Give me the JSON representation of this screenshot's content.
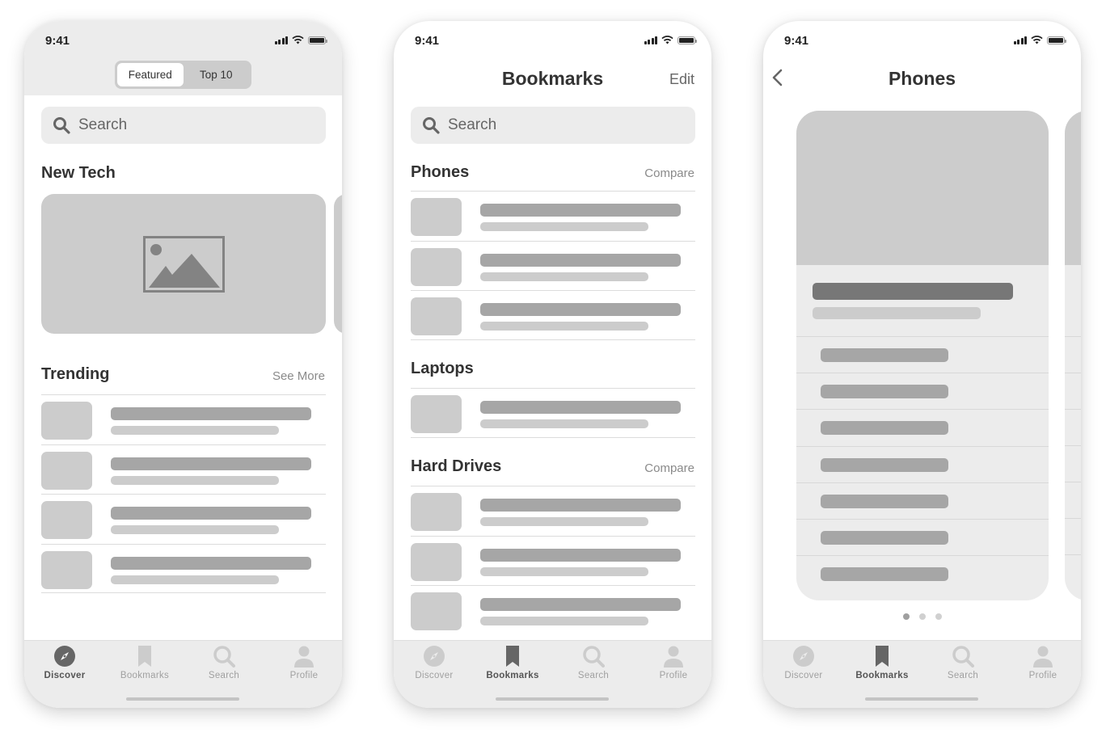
{
  "status_bar": {
    "time": "9:41"
  },
  "discover_screen": {
    "segmented": [
      {
        "label": "Featured",
        "active": true
      },
      {
        "label": "Top 10",
        "active": false
      }
    ],
    "search_placeholder": "Search",
    "new_tech_title": "New Tech",
    "trending_title": "Trending",
    "see_more": "See More",
    "trending_count": 4
  },
  "bookmarks_screen": {
    "title": "Bookmarks",
    "edit": "Edit",
    "search_placeholder": "Search",
    "sections": [
      {
        "title": "Phones",
        "action": "Compare",
        "count": 3
      },
      {
        "title": "Laptops",
        "action": "",
        "count": 1
      },
      {
        "title": "Hard Drives",
        "action": "Compare",
        "count": 3
      }
    ]
  },
  "phones_screen": {
    "title": "Phones",
    "spec_rows": 7,
    "page_dots": 3,
    "active_dot": 0
  },
  "tabbar": {
    "tabs": [
      {
        "label": "Discover",
        "icon": "compass-icon"
      },
      {
        "label": "Bookmarks",
        "icon": "bookmark-icon"
      },
      {
        "label": "Search",
        "icon": "search-icon"
      },
      {
        "label": "Profile",
        "icon": "person-icon"
      }
    ]
  },
  "colors": {
    "active_icon": "#666666",
    "inactive_icon": "#cccccc",
    "panel": "#ececec",
    "placeholder": "#cccccc",
    "bar_dark": "#a6a6a6"
  }
}
